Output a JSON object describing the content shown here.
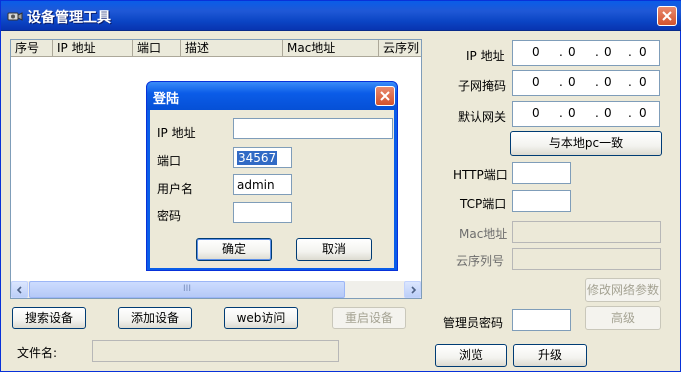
{
  "window": {
    "title": "设备管理工具"
  },
  "list": {
    "columns": [
      "序号",
      "IP 地址",
      "端口",
      "描述",
      "Mac地址",
      "云序列"
    ],
    "scroll_thumb": "III"
  },
  "buttons": {
    "search": "搜索设备",
    "add": "添加设备",
    "web": "web访问",
    "restart": "重启设备",
    "same_as_pc": "与本地pc一致",
    "modify_network": "修改网络参数",
    "advanced": "高级",
    "browse": "浏览",
    "upgrade": "升级"
  },
  "file": {
    "label": "文件名:",
    "value": ""
  },
  "network": {
    "ip_label": "IP 地址",
    "mask_label": "子网掩码",
    "gateway_label": "默认网关",
    "ip": [
      "0",
      "0",
      "0",
      "0"
    ],
    "mask": [
      "0",
      "0",
      "0",
      "0"
    ],
    "gateway": [
      "0",
      "0",
      "0",
      "0"
    ],
    "http_label": "HTTP端口",
    "http_value": "",
    "tcp_label": "TCP端口",
    "tcp_value": "",
    "mac_label": "Mac地址",
    "mac_value": "",
    "cloud_label": "云序列号",
    "cloud_value": "",
    "admin_pwd_label": "管理员密码",
    "admin_pwd_value": ""
  },
  "login": {
    "title": "登陆",
    "ip_label": "IP 地址",
    "ip_value": "",
    "port_label": "端口",
    "port_value": "34567",
    "user_label": "用户名",
    "user_value": "admin",
    "pwd_label": "密码",
    "pwd_value": "",
    "ok": "确定",
    "cancel": "取消"
  }
}
